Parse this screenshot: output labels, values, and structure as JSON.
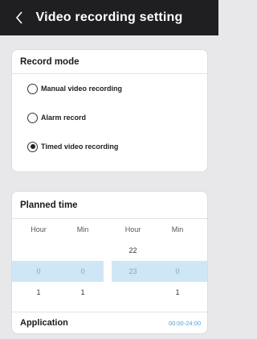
{
  "header": {
    "title": "Video recording setting",
    "back_icon": "chevron-left-icon"
  },
  "record_mode": {
    "title": "Record mode",
    "options": [
      {
        "label": "Manual video recording",
        "checked": false
      },
      {
        "label": "Alarm record",
        "checked": false
      },
      {
        "label": "Timed video recording",
        "checked": true
      }
    ]
  },
  "planned_time": {
    "title": "Planned time",
    "columns": [
      "Hour",
      "Min",
      "Hour",
      "Min"
    ],
    "rows": [
      [
        "",
        "",
        "22",
        ""
      ],
      [
        "0",
        "0",
        "23",
        "0"
      ],
      [
        "1",
        "1",
        "",
        "1"
      ]
    ],
    "selected_row": 1,
    "application_label": "Application",
    "application_value": "00:00-24:00"
  },
  "colors": {
    "topbar": "#1f1f21",
    "selection": "#cfe6f6",
    "accent": "#4a9fd8"
  }
}
